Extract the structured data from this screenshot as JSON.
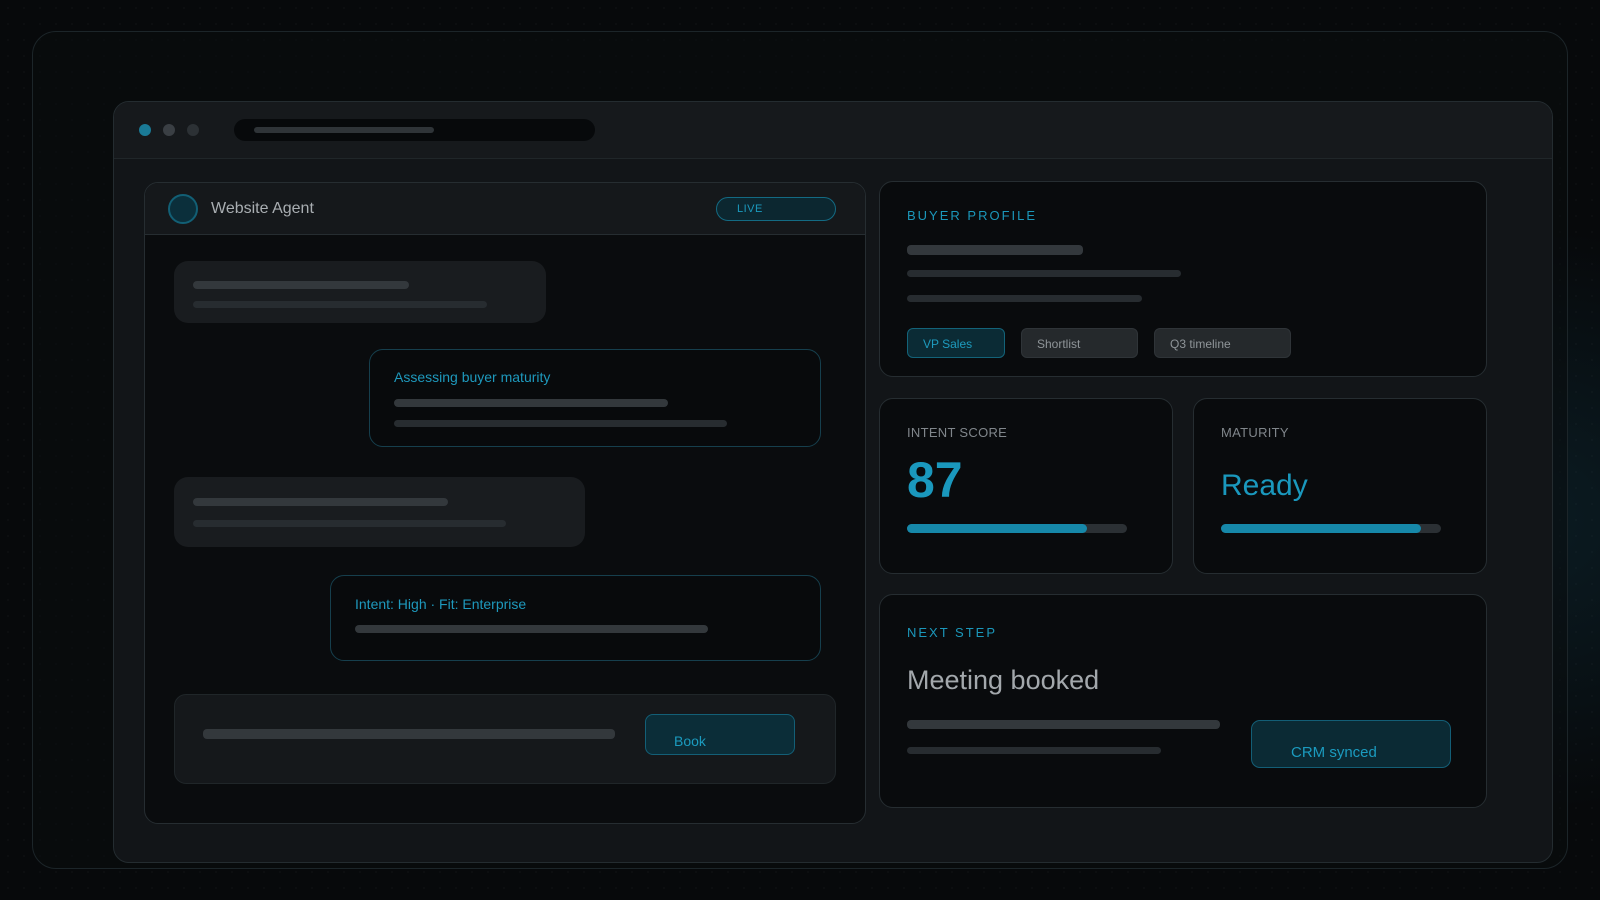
{
  "chat": {
    "agent_name": "Website Agent",
    "status_badge": "LIVE",
    "messages": [
      {
        "role": "visitor"
      },
      {
        "role": "agent",
        "text": "Assessing buyer maturity"
      },
      {
        "role": "visitor"
      },
      {
        "role": "agent",
        "text": "Intent: High · Fit: Enterprise"
      }
    ],
    "book_label": "Book"
  },
  "buyer_profile": {
    "label": "BUYER PROFILE",
    "tags": [
      "VP Sales",
      "Shortlist",
      "Q3 timeline"
    ]
  },
  "intent": {
    "label": "INTENT SCORE",
    "value": "87",
    "progress": 0.82
  },
  "maturity": {
    "label": "MATURITY",
    "value": "Ready",
    "progress": 0.91
  },
  "next_step": {
    "label": "NEXT STEP",
    "headline": "Meeting booked",
    "action_label": "CRM synced"
  },
  "colors": {
    "accent": "#1a98bd",
    "background": "#07090b",
    "panel": "#090b0d",
    "placeholder_bar": "#33383c"
  }
}
